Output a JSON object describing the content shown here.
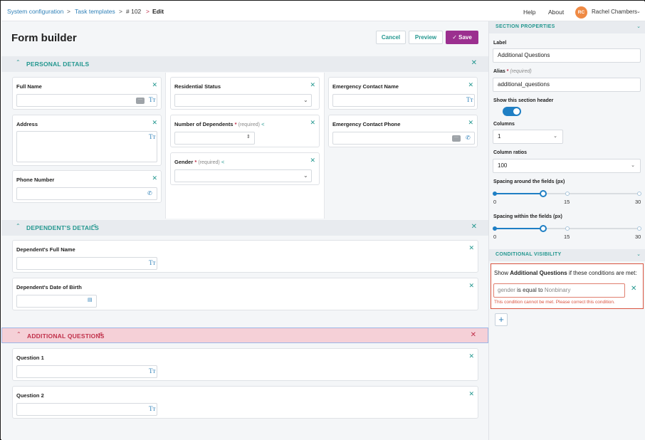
{
  "breadcrumb": {
    "item1": "System configuration",
    "item2": "Task templates",
    "item3": "# 102",
    "current": "Edit"
  },
  "header": {
    "help": "Help",
    "about": "About",
    "user_initials": "RC",
    "user_name": "Rachel Chambers"
  },
  "page": {
    "title": "Form builder",
    "cancel": "Cancel",
    "preview": "Preview",
    "save": "Save"
  },
  "sections": {
    "personal": {
      "title": "PERSONAL DETAILS",
      "fields": {
        "full_name": "Full Name",
        "address": "Address",
        "phone": "Phone Number",
        "residential": "Residential Status",
        "dependents": "Number of Dependents",
        "gender": "Gender",
        "emergency_name": "Emergency Contact Name",
        "emergency_phone": "Emergency Contact Phone"
      },
      "required_text": "(required)"
    },
    "dependents": {
      "title": "DEPENDENT'S DETAILS",
      "fields": {
        "full_name": "Dependent's Full Name",
        "dob": "Dependent's Date of Birth"
      }
    },
    "additional": {
      "title": "ADDITIONAL QUESTIONS",
      "fields": {
        "q1": "Question 1",
        "q2": "Question 2"
      }
    }
  },
  "side": {
    "section_properties": "SECTION PROPERTIES",
    "label_label": "Label",
    "label_value": "Additional Questions",
    "alias_label": "Alias",
    "alias_req": "(required)",
    "alias_value": "additional_questions",
    "show_header_label": "Show this section header",
    "show_header_on": true,
    "columns_label": "Columns",
    "columns_value": "1",
    "ratios_label": "Column ratios",
    "ratios_value": "100",
    "spacing_around_label": "Spacing around the fields (px)",
    "spacing_within_label": "Spacing within the fields (px)",
    "slider_min": "0",
    "slider_mid": "15",
    "slider_max": "30",
    "spacing_around_value": 10,
    "spacing_within_value": 10,
    "conditional_visibility": "CONDITIONAL VISIBILITY",
    "cond_show": "Show",
    "cond_section": "Additional Questions",
    "cond_suffix": "if these conditions are met:",
    "cond_field": "gender",
    "cond_op": "is equal to",
    "cond_value": "Nonbinary",
    "cond_error": "This condition cannot be met. Please correct this condition."
  },
  "colors": {
    "accent": "#23978f",
    "link": "#2f80b8",
    "save": "#9b2f8f",
    "error": "#d9533f",
    "toggle": "#1f7fc4"
  }
}
